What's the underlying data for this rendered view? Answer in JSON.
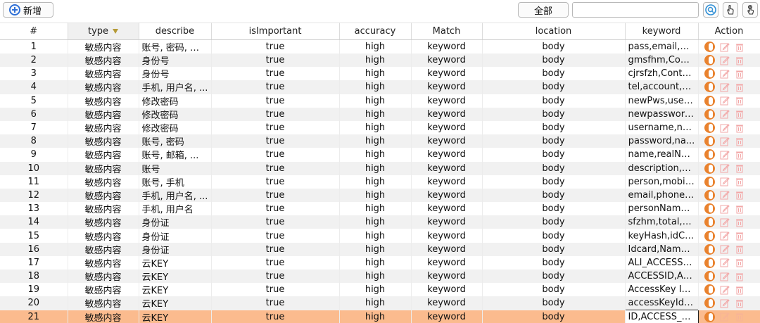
{
  "toolbar": {
    "add_label": "新增",
    "filter_all_label": "全部",
    "search_value": ""
  },
  "columns": [
    "#",
    "type",
    "describe",
    "isImportant",
    "accuracy",
    "Match",
    "location",
    "keyword",
    "Action"
  ],
  "rows": [
    {
      "num": "1",
      "type": "敏感内容",
      "describe": "账号, 密码, 邮箱",
      "important": "true",
      "accuracy": "high",
      "match": "keyword",
      "location": "body",
      "keyword": "pass,email,us..."
    },
    {
      "num": "2",
      "type": "敏感内容",
      "describe": "身份号",
      "important": "true",
      "accuracy": "high",
      "match": "keyword",
      "location": "body",
      "keyword": "gmsfhm,Conte..."
    },
    {
      "num": "3",
      "type": "敏感内容",
      "describe": "身份号",
      "important": "true",
      "accuracy": "high",
      "match": "keyword",
      "location": "body",
      "keyword": "cjrsfzh,Conten..."
    },
    {
      "num": "4",
      "type": "敏感内容",
      "describe": "手机, 用户名, ...",
      "important": "true",
      "accuracy": "high",
      "match": "keyword",
      "location": "body",
      "keyword": "tel,account,us..."
    },
    {
      "num": "5",
      "type": "敏感内容",
      "describe": "修改密码",
      "important": "true",
      "accuracy": "high",
      "match": "keyword",
      "location": "body",
      "keyword": "newPws,user..."
    },
    {
      "num": "6",
      "type": "敏感内容",
      "describe": "修改密码",
      "important": "true",
      "accuracy": "high",
      "match": "keyword",
      "location": "body",
      "keyword": "newpassword..."
    },
    {
      "num": "7",
      "type": "敏感内容",
      "describe": "修改密码",
      "important": "true",
      "accuracy": "high",
      "match": "keyword",
      "location": "body",
      "keyword": "username,new..."
    },
    {
      "num": "8",
      "type": "敏感内容",
      "describe": "账号, 密码",
      "important": "true",
      "accuracy": "high",
      "match": "keyword",
      "location": "body",
      "keyword": "password,na..."
    },
    {
      "num": "9",
      "type": "敏感内容",
      "describe": "账号, 邮箱, ...",
      "important": "true",
      "accuracy": "high",
      "match": "keyword",
      "location": "body",
      "keyword": "name,realNam..."
    },
    {
      "num": "10",
      "type": "敏感内容",
      "describe": "账号",
      "important": "true",
      "accuracy": "high",
      "match": "keyword",
      "location": "body",
      "keyword": "description,na..."
    },
    {
      "num": "11",
      "type": "敏感内容",
      "describe": "账号, 手机",
      "important": "true",
      "accuracy": "high",
      "match": "keyword",
      "location": "body",
      "keyword": "person,mobilP..."
    },
    {
      "num": "12",
      "type": "敏感内容",
      "describe": "手机, 用户名, ...",
      "important": "true",
      "accuracy": "high",
      "match": "keyword",
      "location": "body",
      "keyword": "email,phone,p..."
    },
    {
      "num": "13",
      "type": "敏感内容",
      "describe": "手机, 用户名",
      "important": "true",
      "accuracy": "high",
      "match": "keyword",
      "location": "body",
      "keyword": "personName,..."
    },
    {
      "num": "14",
      "type": "敏感内容",
      "describe": "身份证",
      "important": "true",
      "accuracy": "high",
      "match": "keyword",
      "location": "body",
      "keyword": "sfzhm,total,rows"
    },
    {
      "num": "15",
      "type": "敏感内容",
      "describe": "身份证",
      "important": "true",
      "accuracy": "high",
      "match": "keyword",
      "location": "body",
      "keyword": "keyHash,idCa..."
    },
    {
      "num": "16",
      "type": "敏感内容",
      "describe": "身份证",
      "important": "true",
      "accuracy": "high",
      "match": "keyword",
      "location": "body",
      "keyword": "Idcard,Name,i..."
    },
    {
      "num": "17",
      "type": "敏感内容",
      "describe": "云KEY",
      "important": "true",
      "accuracy": "high",
      "match": "keyword",
      "location": "body",
      "keyword": "ALI_ACCESS_I..."
    },
    {
      "num": "18",
      "type": "敏感内容",
      "describe": "云KEY",
      "important": "true",
      "accuracy": "high",
      "match": "keyword",
      "location": "body",
      "keyword": "ACCESSID,AC..."
    },
    {
      "num": "19",
      "type": "敏感内容",
      "describe": "云KEY",
      "important": "true",
      "accuracy": "high",
      "match": "keyword",
      "location": "body",
      "keyword": "AccessKey ID..."
    },
    {
      "num": "20",
      "type": "敏感内容",
      "describe": "云KEY",
      "important": "true",
      "accuracy": "high",
      "match": "keyword",
      "location": "body",
      "keyword": "accessKeyId,..."
    },
    {
      "num": "21",
      "type": "敏感内容",
      "describe": "云KEY",
      "important": "true",
      "accuracy": "high",
      "match": "keyword",
      "location": "body",
      "keyword": "ID,ACCESS_KEY"
    }
  ],
  "selected_row": 21,
  "colors": {
    "selected_row": "#fbbb8e",
    "toggle": "#e9822e",
    "accent": "#2f6fd6"
  }
}
